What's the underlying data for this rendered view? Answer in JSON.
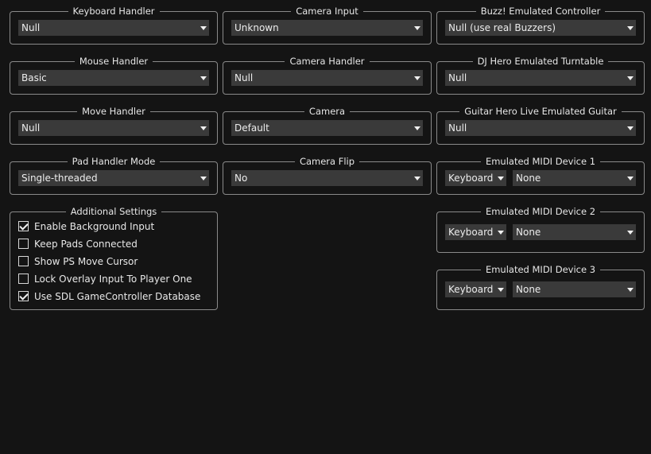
{
  "keyboard_handler": {
    "title": "Keyboard Handler",
    "value": "Null"
  },
  "camera_input": {
    "title": "Camera Input",
    "value": "Unknown"
  },
  "buzz_controller": {
    "title": "Buzz! Emulated Controller",
    "value": "Null (use real Buzzers)"
  },
  "mouse_handler": {
    "title": "Mouse Handler",
    "value": "Basic"
  },
  "camera_handler": {
    "title": "Camera Handler",
    "value": "Null"
  },
  "dj_hero": {
    "title": "DJ Hero Emulated Turntable",
    "value": "Null"
  },
  "move_handler": {
    "title": "Move Handler",
    "value": "Null"
  },
  "camera": {
    "title": "Camera",
    "value": "Default"
  },
  "guitar_hero": {
    "title": "Guitar Hero Live Emulated Guitar",
    "value": "Null"
  },
  "pad_handler_mode": {
    "title": "Pad Handler Mode",
    "value": "Single-threaded"
  },
  "camera_flip": {
    "title": "Camera Flip",
    "value": "No"
  },
  "midi1": {
    "title": "Emulated MIDI Device 1",
    "type_value": "Keyboard",
    "device_value": "None"
  },
  "midi2": {
    "title": "Emulated MIDI Device 2",
    "type_value": "Keyboard",
    "device_value": "None"
  },
  "midi3": {
    "title": "Emulated MIDI Device 3",
    "type_value": "Keyboard",
    "device_value": "None"
  },
  "additional": {
    "title": "Additional Settings",
    "items": [
      {
        "label": "Enable Background Input",
        "checked": true
      },
      {
        "label": "Keep Pads Connected",
        "checked": false
      },
      {
        "label": "Show PS Move Cursor",
        "checked": false
      },
      {
        "label": "Lock Overlay Input To Player One",
        "checked": false
      },
      {
        "label": "Use SDL GameController Database",
        "checked": true
      }
    ]
  }
}
